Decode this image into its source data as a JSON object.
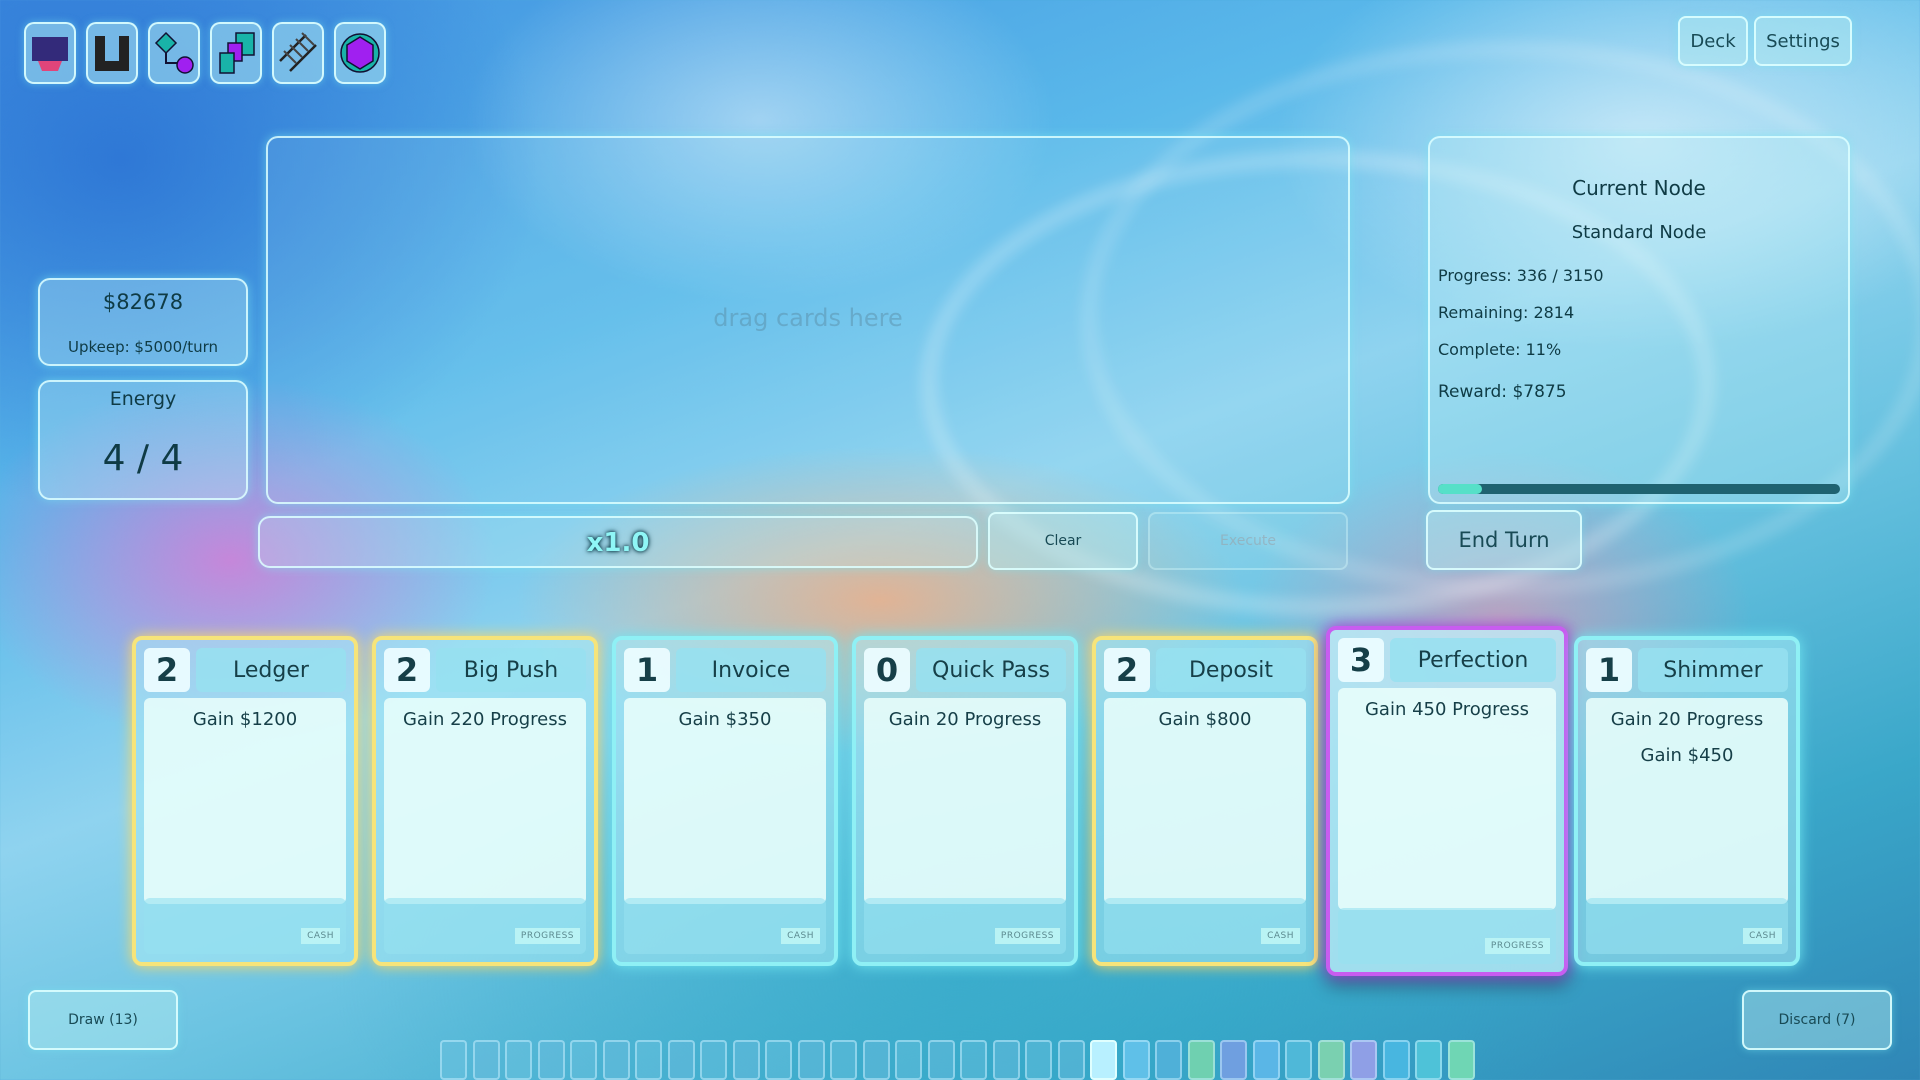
{
  "toolbar": {
    "icons": [
      "block-icon",
      "u-shape-icon",
      "diamond-circle-icon",
      "stacked-squares-icon",
      "rail-icon",
      "hexagon-icon"
    ]
  },
  "top_buttons": {
    "deck": "Deck",
    "settings": "Settings"
  },
  "stats": {
    "money": "$82678",
    "upkeep": "Upkeep: $5000/turn",
    "energy_label": "Energy",
    "energy_value": "4 / 4"
  },
  "play_area": {
    "placeholder": "drag cards here",
    "multiplier": "x1.0",
    "clear": "Clear",
    "execute": "Execute"
  },
  "node": {
    "title": "Current Node",
    "type": "Standard Node",
    "progress": "Progress: 336 / 3150",
    "remaining": "Remaining: 2814",
    "complete": "Complete: 11%",
    "reward": "Reward: $7875",
    "progress_fraction": 0.11
  },
  "end_turn": "End Turn",
  "hand": [
    {
      "cost": "2",
      "name": "Ledger",
      "effects": [
        "Gain $1200"
      ],
      "tag": "CASH",
      "frame": "yellow"
    },
    {
      "cost": "2",
      "name": "Big Push",
      "effects": [
        "Gain 220 Progress"
      ],
      "tag": "PROGRESS",
      "frame": "yellow"
    },
    {
      "cost": "1",
      "name": "Invoice",
      "effects": [
        "Gain $350"
      ],
      "tag": "CASH",
      "frame": "cyan"
    },
    {
      "cost": "0",
      "name": "Quick Pass",
      "effects": [
        "Gain 20 Progress"
      ],
      "tag": "PROGRESS",
      "frame": "cyan"
    },
    {
      "cost": "2",
      "name": "Deposit",
      "effects": [
        "Gain $800"
      ],
      "tag": "CASH",
      "frame": "yellow"
    },
    {
      "cost": "3",
      "name": "Perfection",
      "effects": [
        "Gain 450 Progress"
      ],
      "tag": "PROGRESS",
      "frame": "purple"
    },
    {
      "cost": "1",
      "name": "Shimmer",
      "effects": [
        "Gain 20 Progress",
        "Gain $450"
      ],
      "tag": "CASH",
      "frame": "cyan"
    }
  ],
  "piles": {
    "draw": "Draw (13)",
    "discard": "Discard (7)"
  },
  "colors": {
    "card_yellow": "#f6e47a",
    "card_cyan": "#8ff0f5",
    "card_purple": "#c85cf0",
    "progress_fill": "#56e0c8"
  }
}
